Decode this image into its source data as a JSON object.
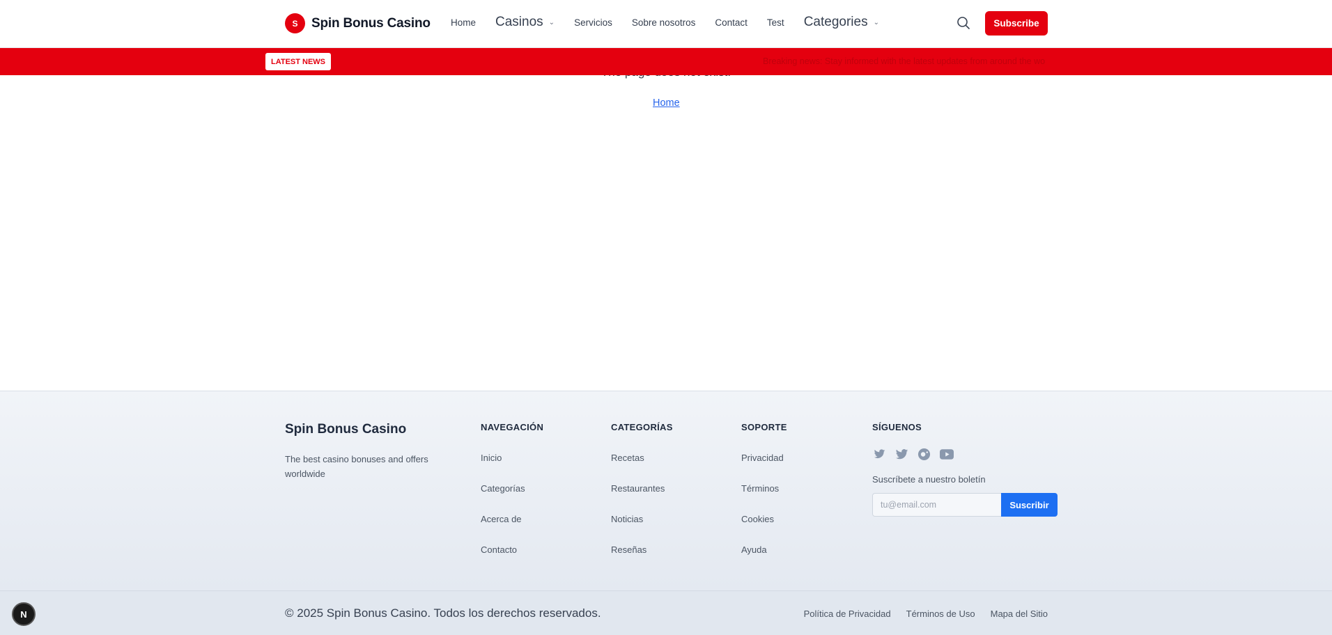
{
  "header": {
    "logo_letter": "S",
    "brand": "Spin Bonus Casino",
    "nav": [
      {
        "label": "Home",
        "dropdown": false
      },
      {
        "label": "Casinos",
        "dropdown": true
      },
      {
        "label": "Servicios",
        "dropdown": false
      },
      {
        "label": "Sobre nosotros",
        "dropdown": false
      },
      {
        "label": "Contact",
        "dropdown": false
      },
      {
        "label": "Test",
        "dropdown": false
      },
      {
        "label": "Categories",
        "dropdown": true
      }
    ],
    "subscribe_label": "Subscribe",
    "accent_color": "#e4000f"
  },
  "ticker": {
    "badge": "LATEST NEWS",
    "text": "Breaking news: Stay informed with the latest updates from around the wo"
  },
  "main": {
    "message": "The page does not exist.",
    "home_link": "Home"
  },
  "footer": {
    "brand": "Spin Bonus Casino",
    "tagline": "The best casino bonuses and offers worldwide",
    "columns": [
      {
        "title": "NAVEGACIÓN",
        "links": [
          "Inicio",
          "Categorías",
          "Acerca de",
          "Contacto"
        ]
      },
      {
        "title": "CATEGORÍAS",
        "links": [
          "Recetas",
          "Restaurantes",
          "Noticias",
          "Reseñas"
        ]
      },
      {
        "title": "SOPORTE",
        "links": [
          "Privacidad",
          "Términos",
          "Cookies",
          "Ayuda"
        ]
      }
    ],
    "social": {
      "title": "SÍGUENOS",
      "icons": [
        "twitter-icon",
        "twitter-icon",
        "social-icon",
        "youtube-icon"
      ],
      "newsletter_label": "Suscríbete a nuestro boletín",
      "email_placeholder": "tu@email.com",
      "newsletter_button": "Suscribir"
    },
    "copyright": "© 2025 Spin Bonus Casino. Todos los derechos reservados.",
    "bottom_links": [
      "Política de Privacidad",
      "Términos de Uso",
      "Mapa del Sitio"
    ]
  },
  "dev_badge": "N"
}
